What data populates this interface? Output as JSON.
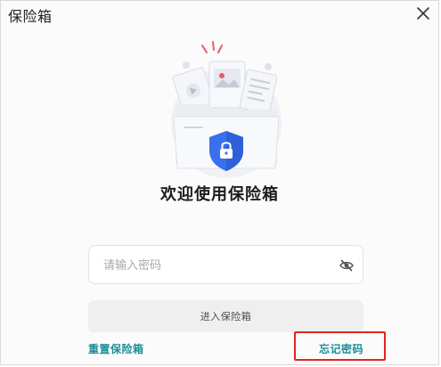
{
  "window": {
    "title": "保险箱"
  },
  "main": {
    "welcome_text": "欢迎使用保险箱",
    "password_placeholder": "请输入密码",
    "enter_button_label": "进入保险箱",
    "reset_link_label": "重置保险箱",
    "forgot_link_label": "忘记密码"
  },
  "icons": {
    "close": "close-icon",
    "eye_toggle": "eye-off-icon",
    "illustration": "safe-box-illustration",
    "shield_lock": "shield-lock-icon"
  },
  "colors": {
    "accent_link": "#1a8f97",
    "shield": "#3a6ff0",
    "highlight": "#e0251f",
    "button_bg": "#efefef"
  }
}
